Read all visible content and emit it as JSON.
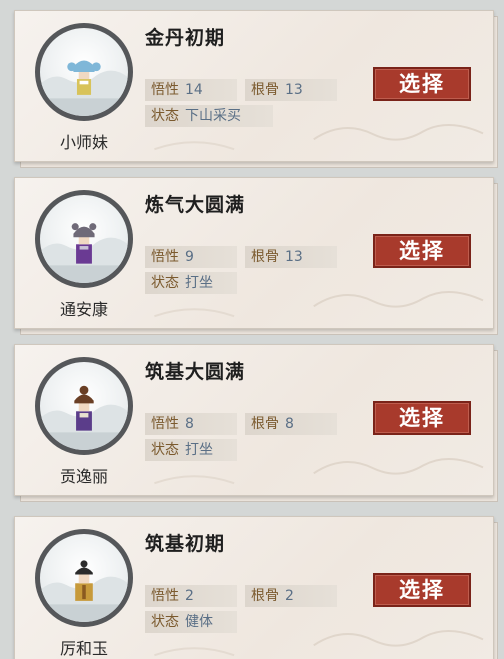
{
  "disciples": [
    {
      "name": "小师妹",
      "realm": "金丹初期",
      "stats": {
        "wuxing_label": "悟性",
        "wuxing": "14",
        "gengu_label": "根骨",
        "gengu": "13",
        "status_label": "状态",
        "status": "下山采买"
      },
      "select_label": "选择",
      "avatar": {
        "hair": "#7fb7d8",
        "robe": "#d8c35a",
        "accent": "#ffffff"
      }
    },
    {
      "name": "通安康",
      "realm": "炼气大圆满",
      "stats": {
        "wuxing_label": "悟性",
        "wuxing": "9",
        "gengu_label": "根骨",
        "gengu": "13",
        "status_label": "状态",
        "status": "打坐"
      },
      "select_label": "选择",
      "avatar": {
        "hair": "#6f6a78",
        "robe": "#6a3a93",
        "accent": "#c9c2d6"
      }
    },
    {
      "name": "贡逸丽",
      "realm": "筑基大圆满",
      "stats": {
        "wuxing_label": "悟性",
        "wuxing": "8",
        "gengu_label": "根骨",
        "gengu": "8",
        "status_label": "状态",
        "status": "打坐"
      },
      "select_label": "选择",
      "avatar": {
        "hair": "#6a3f25",
        "robe": "#5b3d8a",
        "accent": "#e8e0d0"
      }
    },
    {
      "name": "厉和玉",
      "realm": "筑基初期",
      "stats": {
        "wuxing_label": "悟性",
        "wuxing": "2",
        "gengu_label": "根骨",
        "gengu": "2",
        "status_label": "状态",
        "status": "健体"
      },
      "select_label": "选择",
      "avatar": {
        "hair": "#2b2b2b",
        "robe": "#c79a3a",
        "accent": "#8a5a20"
      }
    }
  ]
}
